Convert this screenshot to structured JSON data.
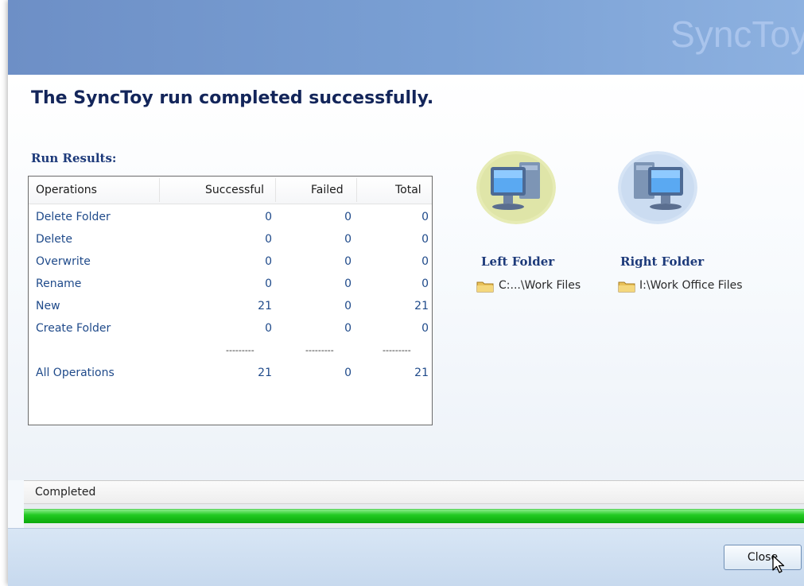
{
  "banner": {
    "brand": "SyncToy"
  },
  "headline": "The SyncToy run completed successfully.",
  "results": {
    "title": "Run Results:",
    "columns": [
      "Operations",
      "Successful",
      "Failed",
      "Total"
    ],
    "rows": [
      {
        "op": "Delete Folder",
        "successful": "0",
        "failed": "0",
        "total": "0"
      },
      {
        "op": "Delete",
        "successful": "0",
        "failed": "0",
        "total": "0"
      },
      {
        "op": "Overwrite",
        "successful": "0",
        "failed": "0",
        "total": "0"
      },
      {
        "op": "Rename",
        "successful": "0",
        "failed": "0",
        "total": "0"
      },
      {
        "op": "New",
        "successful": "21",
        "failed": "0",
        "total": "21"
      },
      {
        "op": "Create Folder",
        "successful": "0",
        "failed": "0",
        "total": "0"
      }
    ],
    "separator": "---------",
    "summary": {
      "op": "All Operations",
      "successful": "21",
      "failed": "0",
      "total": "21"
    }
  },
  "left_folder": {
    "title": "Left Folder",
    "path": "C:...\\Work Files"
  },
  "right_folder": {
    "title": "Right Folder",
    "path": "I:\\Work Office Files"
  },
  "status": {
    "text": "Completed",
    "progress": 1.0
  },
  "footer": {
    "close_label": "Close"
  },
  "colors": {
    "banner": "#7aa0d4",
    "heading": "#13255a",
    "link_text": "#1f4a8a",
    "progress": "#21c921"
  },
  "icons": {
    "left_pc": "computer-icon",
    "right_pc": "computer-icon",
    "folder": "folder-icon",
    "cursor": "mouse-pointer-icon"
  }
}
